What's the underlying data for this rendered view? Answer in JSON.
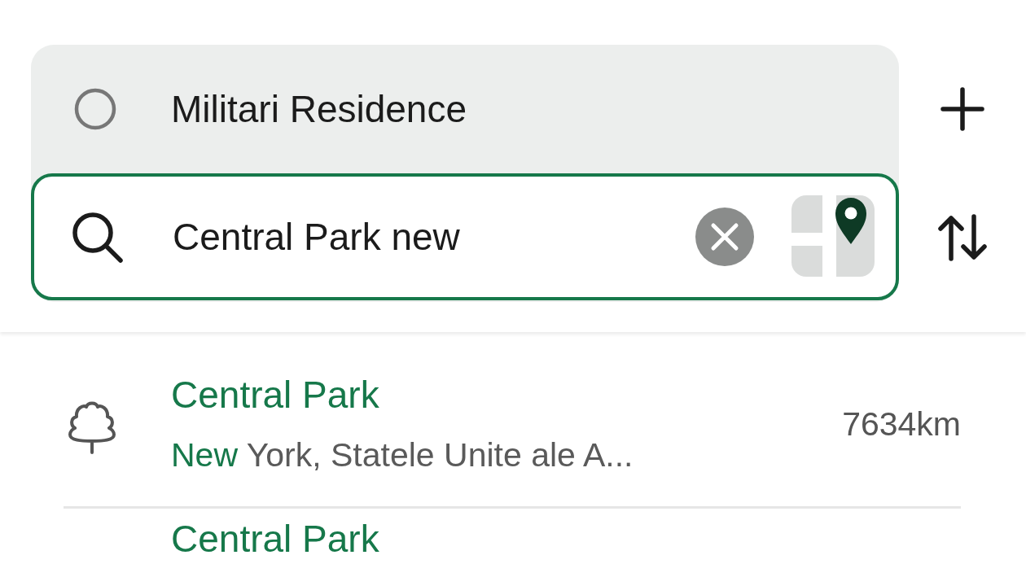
{
  "route": {
    "origin": {
      "label": "Militari Residence"
    },
    "destination": {
      "value": "Central Park new",
      "focused": true
    }
  },
  "results": [
    {
      "kind": "park",
      "title": [
        {
          "text": "Central Park",
          "matched": true
        }
      ],
      "subtitle": [
        {
          "text": "New",
          "matched": true
        },
        {
          "text": "York, Statele Unite ale A...",
          "matched": false
        }
      ],
      "distance": "7634km"
    },
    {
      "kind": "partial",
      "title": [
        {
          "text": "Central Park",
          "matched": true
        }
      ]
    }
  ]
}
